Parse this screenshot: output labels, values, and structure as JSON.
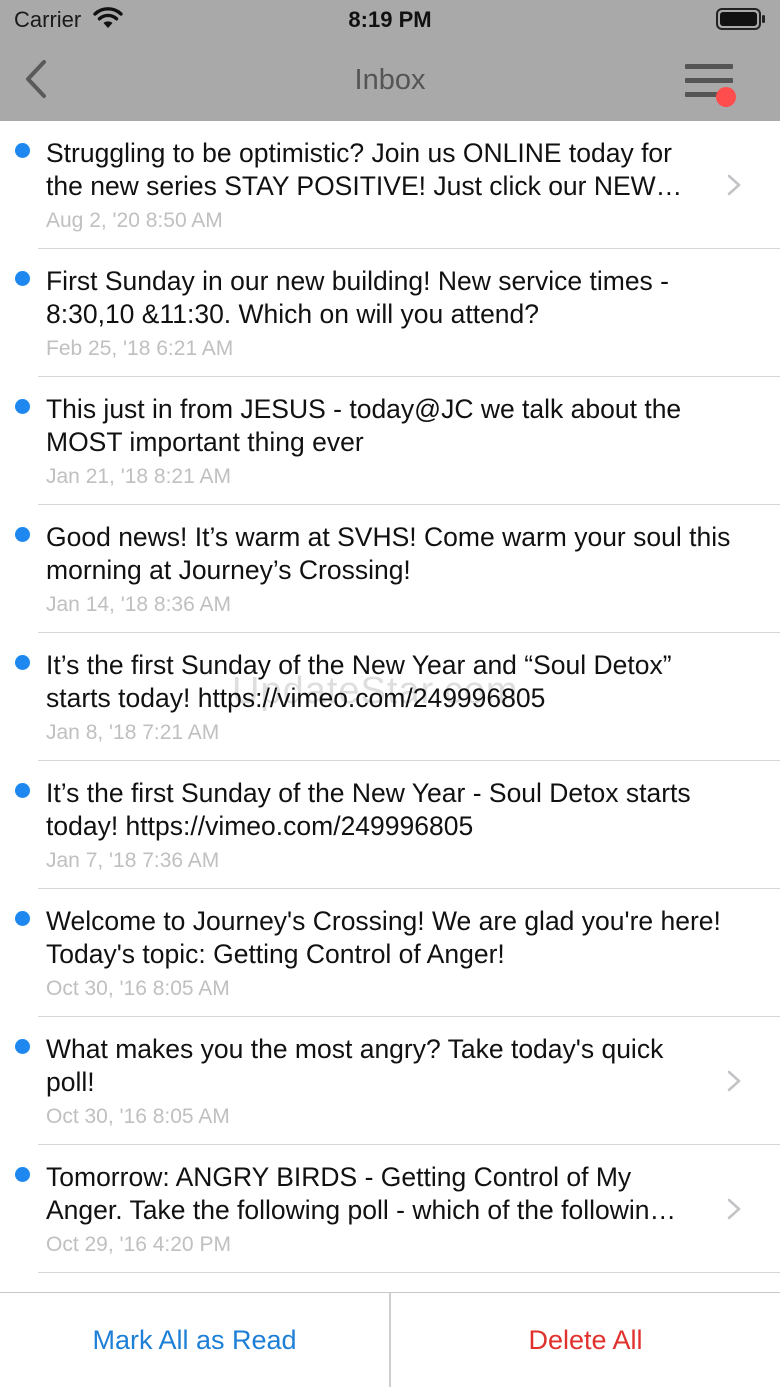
{
  "status_bar": {
    "carrier": "Carrier",
    "time": "8:19 PM"
  },
  "nav": {
    "title": "Inbox",
    "back_icon": "chevron-left-icon",
    "menu_icon": "hamburger-menu-icon",
    "menu_badge_color": "#ff4d4d"
  },
  "messages": [
    {
      "title": "Struggling to be optimistic? Join us ONLINE today for the new series STAY POSITIVE! Just click our NEW…",
      "date": "Aug 2, '20 8:50 AM",
      "unread": true,
      "has_chevron": true
    },
    {
      "title": "First Sunday in our new building! New service times - 8:30,10 &11:30. Which on will you attend?",
      "date": "Feb 25, '18 6:21 AM",
      "unread": true,
      "has_chevron": false
    },
    {
      "title": "This just in from JESUS - today@JC we talk about the MOST important thing ever",
      "date": "Jan 21, '18 8:21 AM",
      "unread": true,
      "has_chevron": false
    },
    {
      "title": "Good news! It’s warm at SVHS! Come warm your soul this morning at Journey’s Crossing!",
      "date": "Jan 14, '18 8:36 AM",
      "unread": true,
      "has_chevron": false
    },
    {
      "title": "It’s the first Sunday of the New Year and “Soul Detox” starts today! https://vimeo.com/249996805",
      "date": "Jan 8, '18 7:21 AM",
      "unread": true,
      "has_chevron": false
    },
    {
      "title": "It’s the first Sunday of the New Year - Soul Detox starts today! https://vimeo.com/249996805",
      "date": "Jan 7, '18 7:36 AM",
      "unread": true,
      "has_chevron": false
    },
    {
      "title": "Welcome to Journey's Crossing! We are glad you're here! Today's topic: Getting Control of Anger!",
      "date": "Oct 30, '16 8:05 AM",
      "unread": true,
      "has_chevron": false
    },
    {
      "title": "What makes you the most angry? Take today's quick poll!",
      "date": "Oct 30, '16 8:05 AM",
      "unread": true,
      "has_chevron": true
    },
    {
      "title": "Tomorrow: ANGRY BIRDS - Getting Control of My Anger. Take the following poll - which of the followin…",
      "date": "Oct 29, '16 4:20 PM",
      "unread": true,
      "has_chevron": true
    }
  ],
  "watermark": "UpdateStar.com",
  "footer": {
    "mark_all_label": "Mark All as Read",
    "delete_all_label": "Delete All",
    "mark_color": "#1e7fd6",
    "delete_color": "#e0312d"
  },
  "colors": {
    "nav_background": "#a9a9a9",
    "unread_dot": "#1e88f0"
  }
}
